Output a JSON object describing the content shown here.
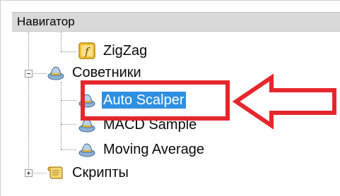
{
  "navigator": {
    "title": "Навигатор"
  },
  "tree": {
    "zigzag": "ZigZag",
    "advisors_folder": "Советники",
    "auto_scalper": "Auto Scalper",
    "macd_sample": "MACD Sample",
    "moving_average": "Moving Average",
    "scripts_folder": "Скрипты"
  },
  "icons": {
    "indicator": "indicator-function-icon",
    "expert": "expert-advisor-hat-icon",
    "script": "script-scroll-icon",
    "expand": "expand-plus-icon",
    "collapse": "collapse-minus-icon"
  },
  "colors": {
    "header_bg": "#d9d9d9",
    "selection": "#2f8fe0",
    "annotation_red": "#e6262d"
  }
}
